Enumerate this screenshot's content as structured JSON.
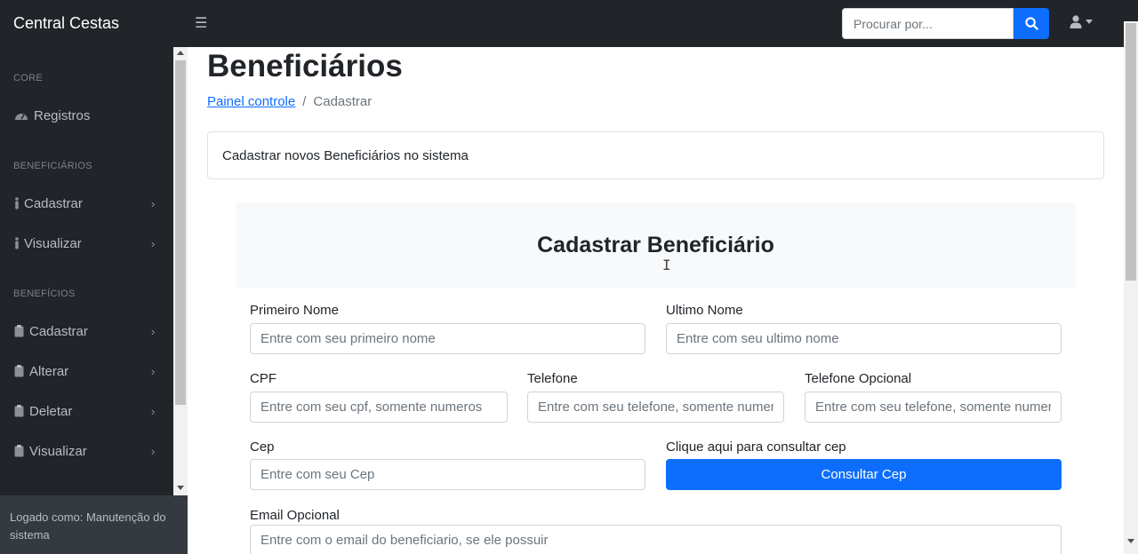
{
  "navbar": {
    "brand": "Central Cestas",
    "search_placeholder": "Procurar por..."
  },
  "sidebar": {
    "sections": [
      {
        "heading": "CORE",
        "items": [
          {
            "label": "Registros",
            "icon": "tachometer-icon"
          }
        ]
      },
      {
        "heading": "BENEFICIÁRIOS",
        "items": [
          {
            "label": "Cadastrar",
            "icon": "person-icon"
          },
          {
            "label": "Visualizar",
            "icon": "person-icon"
          }
        ]
      },
      {
        "heading": "BENEFÍCIOS",
        "items": [
          {
            "label": "Cadastrar",
            "icon": "clipboard-icon"
          },
          {
            "label": "Alterar",
            "icon": "clipboard-icon"
          },
          {
            "label": "Deletar",
            "icon": "clipboard-icon"
          },
          {
            "label": "Visualizar",
            "icon": "clipboard-icon"
          }
        ]
      }
    ],
    "footer": "Logado como: Manutenção do sistema"
  },
  "main": {
    "title": "Beneficiários",
    "breadcrumb": {
      "link": "Painel controle",
      "separator": "/",
      "current": "Cadastrar"
    },
    "card_text": "Cadastrar novos Beneficiários no sistema",
    "form_title": "Cadastrar Beneficiário",
    "fields": {
      "first_name": {
        "label": "Primeiro Nome",
        "placeholder": "Entre com seu primeiro nome"
      },
      "last_name": {
        "label": "Ultimo Nome",
        "placeholder": "Entre com seu ultimo nome"
      },
      "cpf": {
        "label": "CPF",
        "placeholder": "Entre com seu cpf, somente numeros"
      },
      "phone": {
        "label": "Telefone",
        "placeholder": "Entre com seu telefone, somente numeros"
      },
      "phone_opt": {
        "label": "Telefone Opcional",
        "placeholder": "Entre com seu telefone, somente numeros"
      },
      "cep": {
        "label": "Cep",
        "placeholder": "Entre com seu Cep"
      },
      "cep_lookup": {
        "label": "Clique aqui para consultar cep",
        "button": "Consultar Cep"
      },
      "email_opt": {
        "label": "Email Opcional",
        "placeholder": "Entre com o email do beneficiario, se ele possuir"
      }
    }
  },
  "colors": {
    "navbar_bg": "#212529",
    "primary": "#0d6efd",
    "sidebar_footer_bg": "#343a40"
  }
}
